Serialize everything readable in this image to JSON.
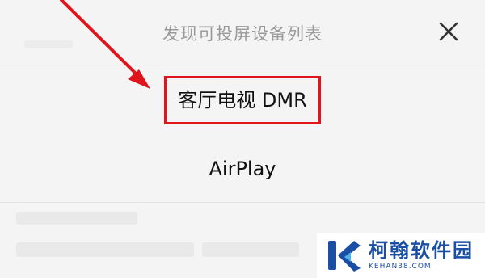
{
  "dialog": {
    "title": "发现可投屏设备列表",
    "close_icon": "close-icon"
  },
  "devices": [
    {
      "label": "客厅电视 DMR",
      "highlighted": true
    },
    {
      "label": "AirPlay",
      "highlighted": false
    }
  ],
  "annotation": {
    "color": "#e2141b"
  },
  "watermark": {
    "name": "柯翰软件园",
    "url": "KEHAN38.COM",
    "color": "#1b4fa5"
  }
}
